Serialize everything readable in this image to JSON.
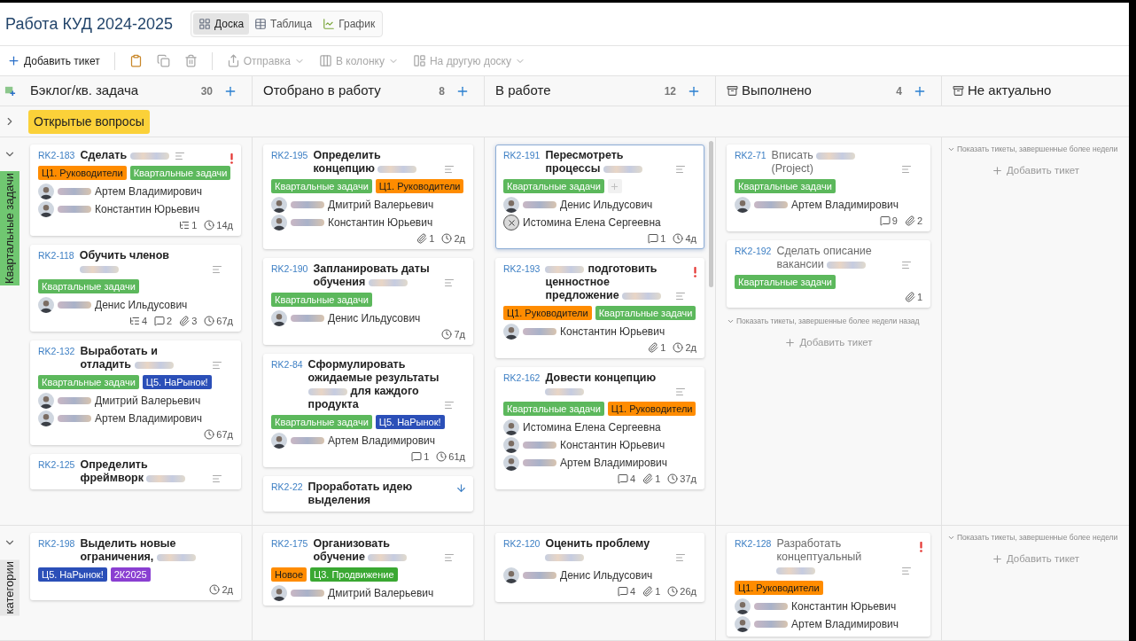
{
  "board": {
    "title": "Работа КУД 2024-2025",
    "views": [
      {
        "kind": "board",
        "label": "Доска",
        "selected": true
      },
      {
        "kind": "table",
        "label": "Таблица",
        "selected": false
      },
      {
        "kind": "chart",
        "label": "График",
        "selected": false
      }
    ]
  },
  "toolbar": [
    {
      "kind": "add",
      "label": "Добавить тикет",
      "disabled": false
    },
    {
      "kind": "paste",
      "disabled": false
    },
    {
      "kind": "copy",
      "disabled": true
    },
    {
      "kind": "delete",
      "disabled": true
    },
    {
      "kind": "send",
      "label": "Отправка",
      "disabled": true
    },
    {
      "kind": "move-column",
      "label": "В колонку",
      "disabled": true
    },
    {
      "kind": "move-board",
      "label": "На другую доску",
      "disabled": true
    }
  ],
  "columns": [
    {
      "name": "Бэклог/кв. задача",
      "count": "30",
      "addable": true
    },
    {
      "name": "Отобрано в работу",
      "count": "8",
      "addable": true
    },
    {
      "name": "В работе",
      "count": "12",
      "addable": true
    },
    {
      "name": "Выполнено",
      "count": "4",
      "addable": true,
      "archive": true
    },
    {
      "name": "Не актуально",
      "archive": true
    }
  ],
  "lanes": [
    {
      "name": "Открытые вопросы",
      "expanded": false,
      "color": "#fbd139"
    },
    {
      "name": "Квартальные задачи",
      "expanded": true,
      "color": "#70c771",
      "cells": [
        {
          "cards": [
            {
              "id": "RK2-183",
              "title": [
                {
                  "kind": "text",
                  "text": "Сделать"
                },
                {
                  "kind": "blurred"
                }
              ],
              "has_description": true,
              "urgent": true,
              "selected": false,
              "tags": [
                {
                  "label": "Ц1. Руководители",
                  "color": "#ff8c00"
                },
                {
                  "label": "Квартальные задачи",
                  "color": "#5cb85c"
                }
              ],
              "people": [
                {
                  "name": "Артем Владимирович",
                  "blurred": true
                },
                {
                  "name": "Константин Юрьевич",
                  "blurred": true
                }
              ],
              "meta": [
                {
                  "kind": "subtasks",
                  "value": "1"
                },
                {
                  "kind": "time",
                  "value": "14д"
                }
              ]
            },
            {
              "id": "RK2-118",
              "title": [
                {
                  "kind": "text",
                  "text": "Обучить членов"
                },
                {
                  "kind": "blurred"
                }
              ],
              "has_description": true,
              "selected": false,
              "tags": [
                {
                  "label": "Квартальные задачи",
                  "color": "#5cb85c"
                }
              ],
              "people": [
                {
                  "name": "Денис Ильдусович",
                  "blurred": true
                }
              ],
              "meta": [
                {
                  "kind": "subtasks",
                  "value": "4"
                },
                {
                  "kind": "comments",
                  "value": "2"
                },
                {
                  "kind": "attachments",
                  "value": "3"
                },
                {
                  "kind": "time",
                  "value": "67д"
                }
              ]
            },
            {
              "id": "RK2-132",
              "title": [
                {
                  "kind": "text",
                  "text": "Выработать и отладить"
                },
                {
                  "kind": "blurred"
                }
              ],
              "has_description": true,
              "selected": false,
              "tags": [
                {
                  "label": "Квартальные задачи",
                  "color": "#5cb85c"
                },
                {
                  "label": "Ц5. НаРынок!",
                  "color": "#2b4fb8"
                }
              ],
              "people": [
                {
                  "name": "Дмитрий Валерьевич",
                  "blurred": true
                },
                {
                  "name": "Артем Владимирович",
                  "blurred": true
                }
              ],
              "meta": [
                {
                  "kind": "time",
                  "value": "67д"
                }
              ]
            },
            {
              "id": "RK2-125",
              "title": [
                {
                  "kind": "text",
                  "text": "Определить фреймворк"
                },
                {
                  "kind": "blurred"
                }
              ],
              "has_description": true,
              "selected": false
            }
          ]
        },
        {
          "cards": [
            {
              "id": "RK2-195",
              "title": [
                {
                  "kind": "text",
                  "text": "Определить концепцию"
                },
                {
                  "kind": "blurred"
                }
              ],
              "has_description": true,
              "selected": false,
              "tags": [
                {
                  "label": "Квартальные задачи",
                  "color": "#5cb85c"
                },
                {
                  "label": "Ц1. Руководители",
                  "color": "#ff8c00"
                }
              ],
              "people": [
                {
                  "name": "Дмитрий Валерьевич",
                  "blurred": true
                },
                {
                  "name": "Константин Юрьевич",
                  "blurred": true
                }
              ],
              "meta": [
                {
                  "kind": "attachments",
                  "value": "1"
                },
                {
                  "kind": "time",
                  "value": "2д"
                }
              ]
            },
            {
              "id": "RK2-190",
              "title": [
                {
                  "kind": "text",
                  "text": "Запланировать даты обучения"
                },
                {
                  "kind": "blurred"
                }
              ],
              "has_description": true,
              "selected": false,
              "tags": [
                {
                  "label": "Квартальные задачи",
                  "color": "#5cb85c"
                }
              ],
              "people": [
                {
                  "name": "Денис Ильдусович",
                  "blurred": true
                }
              ],
              "meta": [
                {
                  "kind": "time",
                  "value": "7д"
                }
              ]
            },
            {
              "id": "RK2-84",
              "title": [
                {
                  "kind": "text",
                  "text": "Сформулировать ожидаемые результаты"
                },
                {
                  "kind": "blurred"
                },
                {
                  "kind": "text",
                  "text": "для каждого продукта"
                }
              ],
              "has_description": true,
              "selected": false,
              "tags": [
                {
                  "label": "Квартальные задачи",
                  "color": "#5cb85c"
                },
                {
                  "label": "Ц5. НаРынок!",
                  "color": "#2b4fb8"
                }
              ],
              "people": [
                {
                  "name": "Артем Владимирович",
                  "blurred": true
                }
              ],
              "meta": [
                {
                  "kind": "comments",
                  "value": "1"
                },
                {
                  "kind": "time",
                  "value": "61д"
                }
              ]
            },
            {
              "id": "RK2-22",
              "title": [
                {
                  "kind": "text",
                  "text": "Проработать идею выделения"
                }
              ],
              "low_priority": true,
              "selected": false
            }
          ]
        },
        {
          "scrollable": true,
          "cards": [
            {
              "id": "RK2-191",
              "title": [
                {
                  "kind": "text",
                  "text": "Пересмотреть процессы"
                },
                {
                  "kind": "blurred"
                }
              ],
              "has_description": true,
              "selected": true,
              "tags": [
                {
                  "label": "Квартальные задачи",
                  "color": "#5cb85c"
                }
              ],
              "add_tag": true,
              "people": [
                {
                  "name": "Денис Ильдусович",
                  "blurred": true
                },
                {
                  "name": "Истомина Елена Сергеевна",
                  "no_photo": true
                }
              ],
              "meta": [
                {
                  "kind": "comments",
                  "value": "1"
                },
                {
                  "kind": "time",
                  "value": "4д"
                }
              ]
            },
            {
              "id": "RK2-193",
              "title": [
                {
                  "kind": "blurred"
                },
                {
                  "kind": "text",
                  "text": "подготовить ценностное предложение"
                },
                {
                  "kind": "blurred"
                }
              ],
              "has_description": true,
              "urgent": true,
              "selected": false,
              "tags": [
                {
                  "label": "Ц1. Руководители",
                  "color": "#ff8c00"
                },
                {
                  "label": "Квартальные задачи",
                  "color": "#5cb85c"
                }
              ],
              "people": [
                {
                  "name": "Константин Юрьевич",
                  "blurred": true
                }
              ],
              "meta": [
                {
                  "kind": "attachments",
                  "value": "1"
                },
                {
                  "kind": "time",
                  "value": "2д"
                }
              ]
            },
            {
              "id": "RK2-162",
              "title": [
                {
                  "kind": "text",
                  "text": "Довести концепцию"
                },
                {
                  "kind": "blurred"
                }
              ],
              "has_description": true,
              "selected": false,
              "tags": [
                {
                  "label": "Квартальные задачи",
                  "color": "#5cb85c"
                },
                {
                  "label": "Ц1. Руководители",
                  "color": "#ff8c00"
                }
              ],
              "people": [
                {
                  "name": "Истомина Елена Сергеевна"
                },
                {
                  "name": "Константин Юрьевич",
                  "blurred": true
                },
                {
                  "name": "Артем Владимирович",
                  "blurred": true
                }
              ],
              "meta": [
                {
                  "kind": "comments",
                  "value": "4"
                },
                {
                  "kind": "attachments",
                  "value": "1"
                },
                {
                  "kind": "time",
                  "value": "37д"
                }
              ]
            }
          ]
        },
        {
          "cards": [
            {
              "id": "RK2-71",
              "title": [
                {
                  "kind": "text",
                  "text": "Вписать"
                },
                {
                  "kind": "blurred"
                },
                {
                  "kind": "text",
                  "text": "(Project)"
                }
              ],
              "has_description": true,
              "done": true,
              "selected": false,
              "tags": [
                {
                  "label": "Квартальные задачи",
                  "color": "#5cb85c"
                }
              ],
              "people": [
                {
                  "name": "Артем Владимирович",
                  "blurred": true
                }
              ],
              "meta": [
                {
                  "kind": "comments",
                  "value": "9"
                },
                {
                  "kind": "attachments",
                  "value": "2"
                }
              ]
            },
            {
              "id": "RK2-192",
              "title": [
                {
                  "kind": "text",
                  "text": "Сделать описание вакансии"
                },
                {
                  "kind": "blurred"
                }
              ],
              "has_description": true,
              "done": true,
              "selected": false,
              "tags": [
                {
                  "label": "Квартальные задачи",
                  "color": "#5cb85c"
                }
              ],
              "meta": [
                {
                  "kind": "attachments",
                  "value": "1"
                }
              ]
            }
          ],
          "show_older": "Показать тикеты, завершенные более недели назад",
          "add_label": "Добавить тикет"
        },
        {
          "show_older": "Показать тикеты, завершенные более недели",
          "add_label": "Добавить тикет"
        }
      ]
    },
    {
      "name": "категории",
      "expanded": true,
      "color": "#e6e6e6",
      "cells": [
        {
          "cards": [
            {
              "id": "RK2-198",
              "title": [
                {
                  "kind": "text",
                  "text": "Выделить новые ограничения,"
                },
                {
                  "kind": "blurred"
                }
              ],
              "selected": false,
              "tags": [
                {
                  "label": "Ц5. НаРынок!",
                  "color": "#2b4fb8"
                },
                {
                  "label": "2К2025",
                  "color": "#8a3fd1"
                }
              ],
              "meta": [
                {
                  "kind": "time",
                  "value": "2д"
                }
              ]
            }
          ]
        },
        {
          "cards": [
            {
              "id": "RK2-175",
              "title": [
                {
                  "kind": "text",
                  "text": "Организовать обучение"
                },
                {
                  "kind": "blurred"
                }
              ],
              "has_description": true,
              "selected": false,
              "tags": [
                {
                  "label": "Новое",
                  "color": "#ff8c00"
                },
                {
                  "label": "Ц3. Продвижение",
                  "color": "#3aa832"
                }
              ],
              "people": [
                {
                  "name": "Дмитрий Валерьевич",
                  "blurred": true
                }
              ]
            }
          ]
        },
        {
          "cards": [
            {
              "id": "RK2-120",
              "title": [
                {
                  "kind": "text",
                  "text": "Оценить проблему"
                },
                {
                  "kind": "blurred"
                }
              ],
              "has_description": true,
              "selected": false,
              "people": [
                {
                  "name": "Денис Ильдусович",
                  "blurred": true
                }
              ],
              "meta": [
                {
                  "kind": "comments",
                  "value": "4"
                },
                {
                  "kind": "attachments",
                  "value": "1"
                },
                {
                  "kind": "time",
                  "value": "26д"
                }
              ]
            }
          ]
        },
        {
          "cards": [
            {
              "id": "RK2-128",
              "title": [
                {
                  "kind": "text",
                  "text": "Разработать концептуальный"
                },
                {
                  "kind": "blurred"
                }
              ],
              "has_description": true,
              "urgent": true,
              "done": true,
              "selected": false,
              "tags": [
                {
                  "label": "Ц1. Руководители",
                  "color": "#ff8c00"
                }
              ],
              "people": [
                {
                  "name": "Константин Юрьевич",
                  "blurred": true
                },
                {
                  "name": "Артем Владимирович",
                  "blurred": true
                }
              ]
            }
          ]
        },
        {
          "show_older": "Показать тикеты, завершенные более недели",
          "add_label": "Добавить тикет"
        }
      ]
    }
  ]
}
